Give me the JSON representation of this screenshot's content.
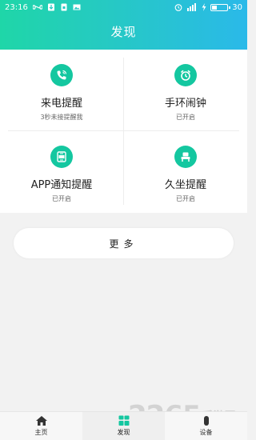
{
  "status_bar": {
    "time": "23:16",
    "battery": "30"
  },
  "header": {
    "title": "发现"
  },
  "features": [
    {
      "name": "来电提醒",
      "status": "3秒未接提醒我",
      "icon": "phone-icon"
    },
    {
      "name": "手环闹钟",
      "status": "已开启",
      "icon": "alarm-clock-icon"
    },
    {
      "name": "APP通知提醒",
      "status": "已开启",
      "icon": "app-notification-icon"
    },
    {
      "name": "久坐提醒",
      "status": "已开启",
      "icon": "sedentary-seat-icon"
    }
  ],
  "more_button": {
    "label": "更多"
  },
  "tabs": [
    {
      "label": "主页",
      "icon": "home-icon",
      "active": false
    },
    {
      "label": "发现",
      "icon": "grid-icon",
      "active": true
    },
    {
      "label": "设备",
      "icon": "device-icon",
      "active": false
    }
  ],
  "watermark": {
    "number": "2265",
    "text": "手游网"
  },
  "colors": {
    "accent": "#14c7a0",
    "header_start": "#1fd6a8",
    "header_end": "#2ab9e9"
  }
}
